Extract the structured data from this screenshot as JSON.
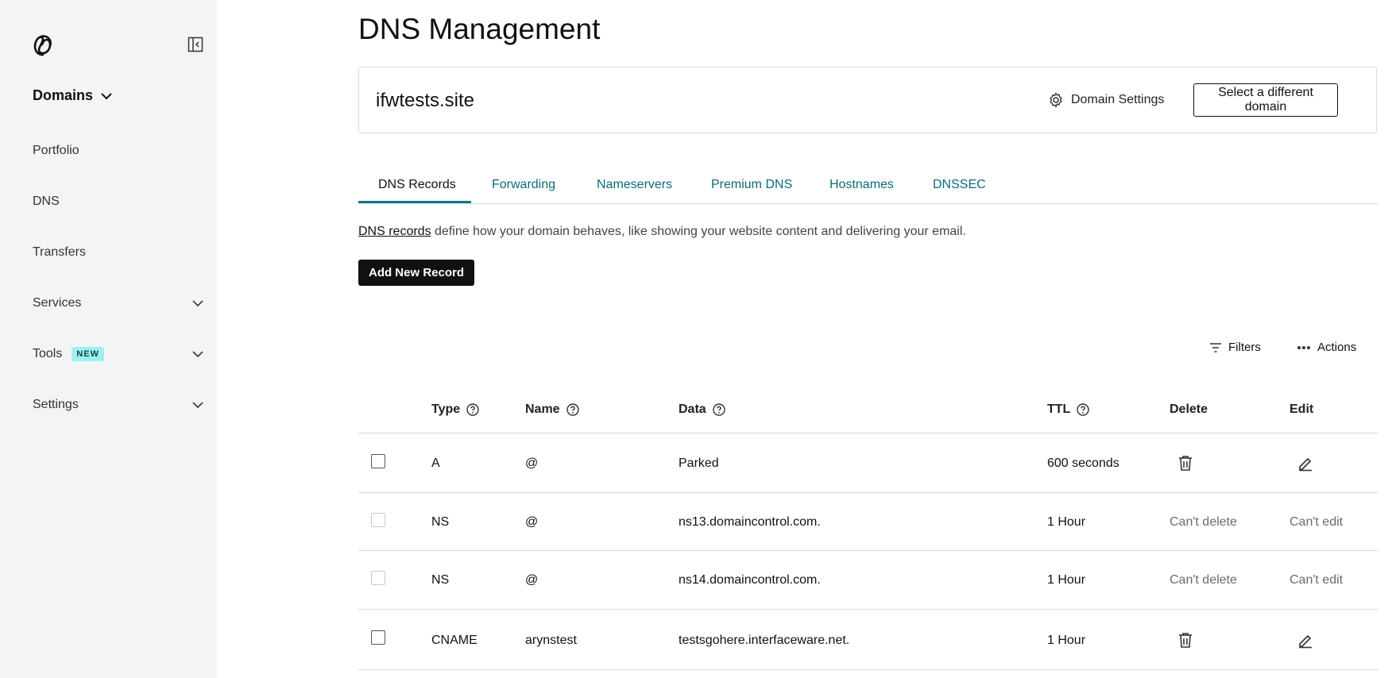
{
  "sidebar": {
    "logo": "godaddy-logo-icon",
    "section_title": "Domains",
    "items": [
      {
        "label": "Portfolio"
      },
      {
        "label": "DNS"
      },
      {
        "label": "Transfers"
      },
      {
        "label": "Services"
      },
      {
        "label": "Tools",
        "badge": "NEW"
      },
      {
        "label": "Settings"
      }
    ]
  },
  "page": {
    "title": "DNS Management",
    "domain": "ifwtests.site",
    "domain_settings_label": "Domain Settings",
    "select_domain_label": "Select a different domain"
  },
  "tabs": [
    {
      "label": "DNS Records",
      "active": true
    },
    {
      "label": "Forwarding"
    },
    {
      "label": "Nameservers"
    },
    {
      "label": "Premium DNS"
    },
    {
      "label": "Hostnames"
    },
    {
      "label": "DNSSEC"
    }
  ],
  "description": {
    "link": "DNS records",
    "text": " define how your domain behaves, like showing your website content and delivering your email."
  },
  "add_button": "Add New Record",
  "toolbar": {
    "filters": "Filters",
    "actions": "Actions"
  },
  "table": {
    "headers": {
      "type": "Type",
      "name": "Name",
      "data": "Data",
      "ttl": "TTL",
      "delete": "Delete",
      "edit": "Edit"
    },
    "rows": [
      {
        "type": "A",
        "name": "@",
        "data": "Parked",
        "ttl": "600 seconds",
        "delete": "trash-icon",
        "edit": "pencil-icon",
        "selectable": true
      },
      {
        "type": "NS",
        "name": "@",
        "data": "ns13.domaincontrol.com.",
        "ttl": "1 Hour",
        "delete": "Can't delete",
        "edit": "Can't edit",
        "selectable": false
      },
      {
        "type": "NS",
        "name": "@",
        "data": "ns14.domaincontrol.com.",
        "ttl": "1 Hour",
        "delete": "Can't delete",
        "edit": "Can't edit",
        "selectable": false
      },
      {
        "type": "CNAME",
        "name": "arynstest",
        "data": "testsgohere.interfaceware.net.",
        "ttl": "1 Hour",
        "delete": "trash-icon",
        "edit": "pencil-icon",
        "selectable": true
      }
    ]
  },
  "colors": {
    "sidebar_bg": "#f3f5f5",
    "tab_link": "#0b6b78",
    "tab_underline": "#0b7a86",
    "badge_bg": "#9ef0f0"
  }
}
